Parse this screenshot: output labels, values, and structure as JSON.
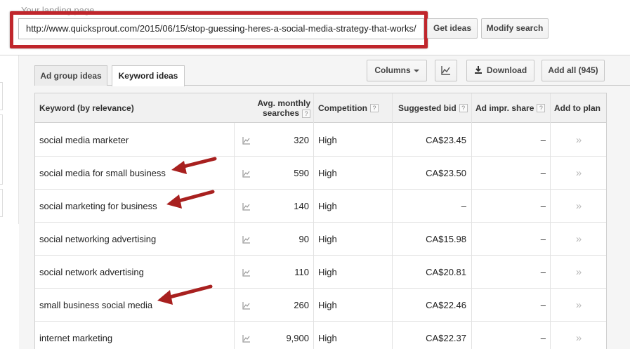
{
  "landing": {
    "label": "Your landing page",
    "url": "http://www.quicksprout.com/2015/06/15/stop-guessing-heres-a-social-media-strategy-that-works/"
  },
  "buttons": {
    "get_ideas": "Get ideas",
    "modify_search": "Modify search",
    "columns": "Columns",
    "download": "Download",
    "add_all": "Add all (945)"
  },
  "tabs": [
    {
      "label": "Ad group ideas",
      "active": false
    },
    {
      "label": "Keyword ideas",
      "active": true
    }
  ],
  "table": {
    "headers": {
      "keyword": "Keyword (by relevance)",
      "searches_line1": "Avg. monthly",
      "searches_line2": "searches",
      "competition": "Competition",
      "bid": "Suggested bid",
      "share": "Ad impr. share",
      "add": "Add to plan",
      "help": "?"
    },
    "rows": [
      {
        "keyword": "social media marketer",
        "searches": "320",
        "competition": "High",
        "bid": "CA$23.45",
        "share": "–",
        "add": "»"
      },
      {
        "keyword": "social media for small business",
        "searches": "590",
        "competition": "High",
        "bid": "CA$23.50",
        "share": "–",
        "add": "»"
      },
      {
        "keyword": "social marketing for business",
        "searches": "140",
        "competition": "High",
        "bid": "–",
        "share": "–",
        "add": "»"
      },
      {
        "keyword": "social networking advertising",
        "searches": "90",
        "competition": "High",
        "bid": "CA$15.98",
        "share": "–",
        "add": "»"
      },
      {
        "keyword": "social network advertising",
        "searches": "110",
        "competition": "High",
        "bid": "CA$20.81",
        "share": "–",
        "add": "»"
      },
      {
        "keyword": "small business social media",
        "searches": "260",
        "competition": "High",
        "bid": "CA$22.46",
        "share": "–",
        "add": "»"
      },
      {
        "keyword": "internet marketing",
        "searches": "9,900",
        "competition": "High",
        "bid": "CA$22.37",
        "share": "–",
        "add": "»"
      }
    ]
  },
  "annotations": {
    "highlight_color": "#c0262c",
    "arrow_color": "#a8201f",
    "arrow_icon": "red-pointer-arrow"
  }
}
